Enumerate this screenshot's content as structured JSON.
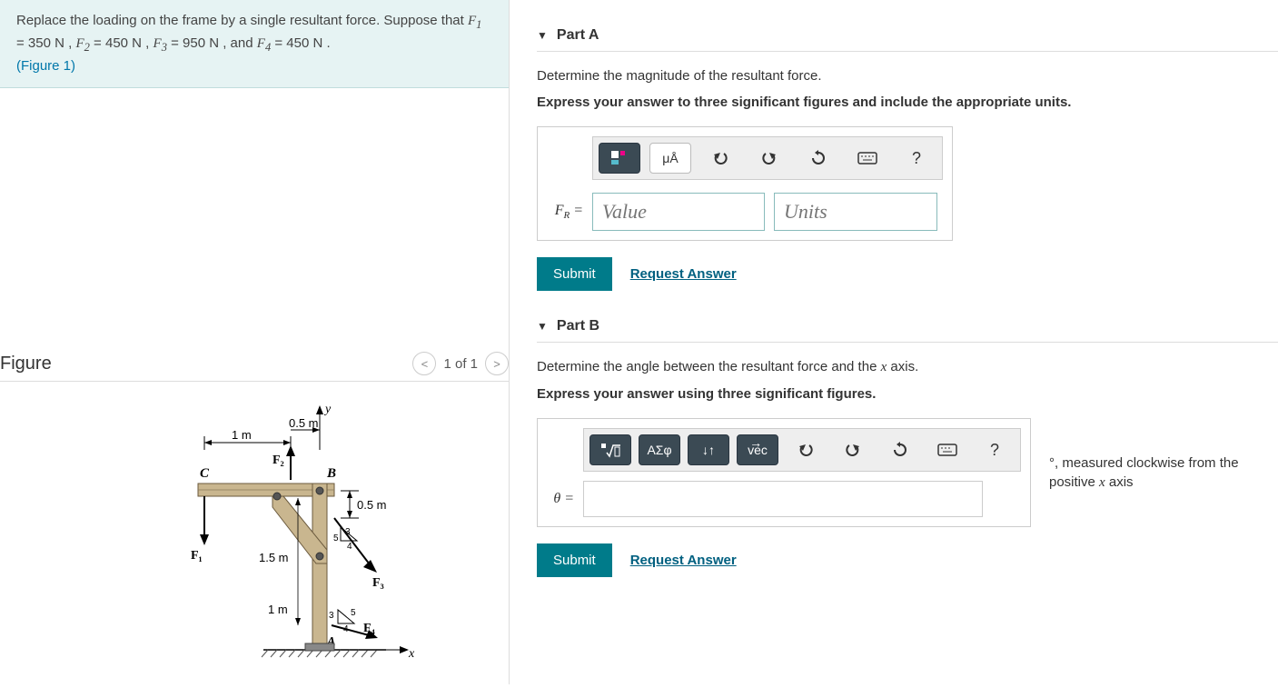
{
  "problem": {
    "text_1": "Replace the loading on the frame by a single resultant force. Suppose that ",
    "f1_label": "F",
    "f1_sub": "1",
    "f1_val": " = 350  N ,",
    "f2_label": "F",
    "f2_sub": "2",
    "f2_val": " = 450  N , ",
    "f3_label": "F",
    "f3_sub": "3",
    "f3_val": " = 950  N , and ",
    "f4_label": "F",
    "f4_sub": "4",
    "f4_val": " = 450  N .",
    "figure_link": "(Figure 1)"
  },
  "figure": {
    "title": "Figure",
    "nav_text": "1 of 1",
    "labels": {
      "y": "y",
      "x": "x",
      "d_05m_top": "0.5 m",
      "d_1m_top": "1 m",
      "d_05m_side": "0.5 m",
      "d_15m": "1.5 m",
      "d_1m_bot": "1 m",
      "C": "C",
      "B": "B",
      "A": "A",
      "F1": "F₁",
      "F2": "F₂",
      "F3": "F₃",
      "F4": "F₄",
      "n3": "3",
      "n4": "4",
      "n5": "5"
    }
  },
  "partA": {
    "title": "Part A",
    "instruction": "Determine the magnitude of the resultant force.",
    "express": "Express your answer to three significant figures and include the appropriate units.",
    "toolbar": {
      "units_btn": "μÅ",
      "help": "?"
    },
    "label": "F",
    "label_sub": "R",
    "eq": " =",
    "value_placeholder": "Value",
    "units_placeholder": "Units",
    "submit": "Submit",
    "request": "Request Answer"
  },
  "partB": {
    "title": "Part B",
    "instruction_1": "Determine the angle between the resultant force and the ",
    "instruction_x": "x",
    "instruction_2": " axis.",
    "express": "Express your answer using three significant figures.",
    "toolbar": {
      "greek": "ΑΣφ",
      "arrows": "↓↑",
      "vec": "vec",
      "help": "?"
    },
    "label": "θ =",
    "suffix_1": "°, measured clockwise from the positive ",
    "suffix_x": "x",
    "suffix_2": " axis",
    "submit": "Submit",
    "request": "Request Answer"
  },
  "chart_data": {
    "type": "diagram",
    "forces_N": {
      "F1": 350,
      "F2": 450,
      "F3": 950,
      "F4": 450
    },
    "dimensions_m": {
      "top_left_span": 1.0,
      "top_right_span": 0.5,
      "side_drop": 0.5,
      "diag_span": 1.5,
      "bottom_span": 1.0
    },
    "slopes": {
      "F3_triangle": {
        "rise": 3,
        "run": 4,
        "hyp": 5
      },
      "F4_triangle": {
        "rise": 3,
        "run": 4,
        "hyp": 5
      }
    },
    "points": [
      "A",
      "B",
      "C"
    ]
  }
}
